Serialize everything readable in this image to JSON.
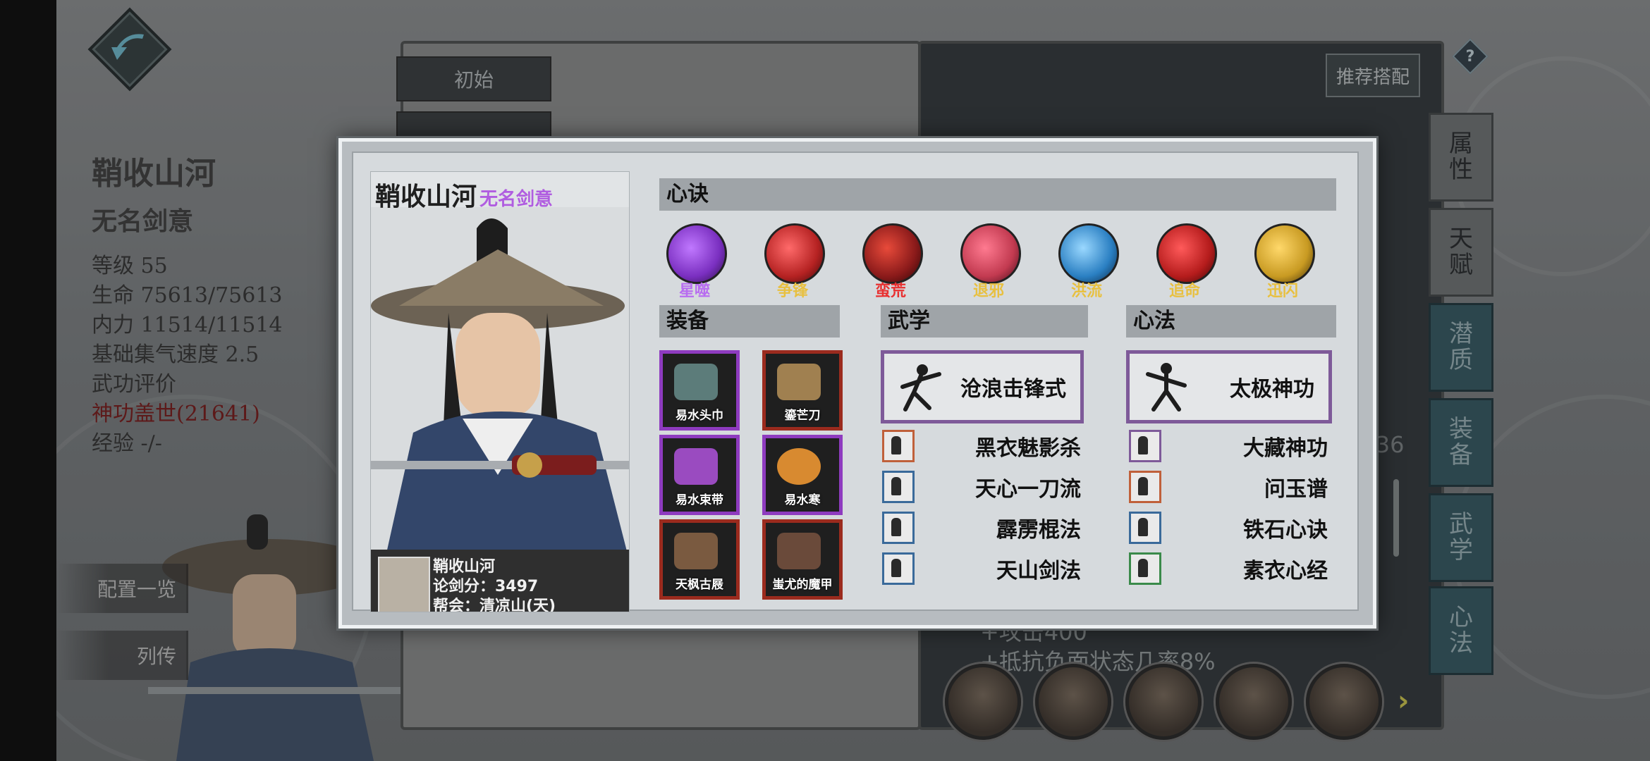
{
  "background": {
    "character": {
      "name": "鞘收山河",
      "title": "无名剑意",
      "stats": [
        {
          "text": "等级 55",
          "color": "#2e2e2e"
        },
        {
          "text": "生命 75613/75613",
          "color": "#2e2e2e"
        },
        {
          "text": "内力 11514/11514",
          "color": "#2e2e2e"
        },
        {
          "text": "基础集气速度 2.5",
          "color": "#2e2e2e"
        },
        {
          "text": "武功评价",
          "color": "#2e2e2e"
        },
        {
          "text": "神功盖世(21641)",
          "color": "#7a1212"
        },
        {
          "text": "经验 -/-",
          "color": "#2e2e2e"
        }
      ]
    },
    "side_buttons": {
      "config": "配置一览",
      "biography": "列传"
    },
    "book": {
      "tab_initial": "初始",
      "recommend_button": "推荐搭配",
      "bonus_lines": [
        "+攻击400",
        "+抵抗负面状态几率8%"
      ],
      "page_counter": "/36"
    },
    "right_tabs": [
      {
        "label": "属\n性"
      },
      {
        "label": "天\n赋"
      },
      {
        "label": "潜\n质"
      },
      {
        "label": "装\n备"
      },
      {
        "label": "武\n学"
      },
      {
        "label": "心\n法"
      }
    ],
    "help_icon_text": "?",
    "next_arrow": "›"
  },
  "dialog": {
    "card": {
      "name": "鞘收山河",
      "title": "无名剑意",
      "info_name": "鞘收山河",
      "info_score": "论剑分：3497",
      "info_guild": "帮会：清凉山(天)"
    },
    "sections": {
      "xinjue": "心诀",
      "equipment": "装备",
      "martial": "武学",
      "mental": "心法"
    },
    "xinjue_skills": [
      {
        "label": "星噬",
        "label_color": "#b86cf0",
        "color": "#7a2fc0"
      },
      {
        "label": "争锋",
        "label_color": "#e8c040",
        "color": "#b52222"
      },
      {
        "label": "蛮荒",
        "label_color": "#e83030",
        "color": "#8a1a1a"
      },
      {
        "label": "退邪",
        "label_color": "#e8c040",
        "color": "#c23a50"
      },
      {
        "label": "洪流",
        "label_color": "#e8c040",
        "color": "#2a7fc2"
      },
      {
        "label": "追命",
        "label_color": "#e8c040",
        "color": "#b51c1c"
      },
      {
        "label": "迅闪",
        "label_color": "#e8c040",
        "color": "#c89a22"
      }
    ],
    "equipment": [
      {
        "label": "易水头巾",
        "rarity": "purple",
        "art_color": "#5c7c7a"
      },
      {
        "label": "鎏芒刀",
        "rarity": "red",
        "art_color": "#a08050"
      },
      {
        "label": "易水束带",
        "rarity": "purple",
        "art_color": "#9a4bc0"
      },
      {
        "label": "易水寒",
        "rarity": "purple",
        "art_color": "#d88a30"
      },
      {
        "label": "天枫古屐",
        "rarity": "red",
        "art_color": "#7a5a40"
      },
      {
        "label": "蚩尤的魔甲",
        "rarity": "red",
        "art_color": "#6a4a3a"
      }
    ],
    "martial_main": "沧浪击锋式",
    "martial_list": [
      {
        "label": "黑衣魅影杀",
        "border": "#c0603a"
      },
      {
        "label": "天心一刀流",
        "border": "#3a6a9a"
      },
      {
        "label": "霹雳棍法",
        "border": "#3a6a9a"
      },
      {
        "label": "天山剑法",
        "border": "#3a6a9a"
      }
    ],
    "mental_main": "太极神功",
    "mental_list": [
      {
        "label": "大藏神功",
        "border": "#7e5a99"
      },
      {
        "label": "问玉谱",
        "border": "#c0603a"
      },
      {
        "label": "铁石心诀",
        "border": "#3a6a9a"
      },
      {
        "label": "素衣心经",
        "border": "#3a8a4a"
      }
    ]
  }
}
